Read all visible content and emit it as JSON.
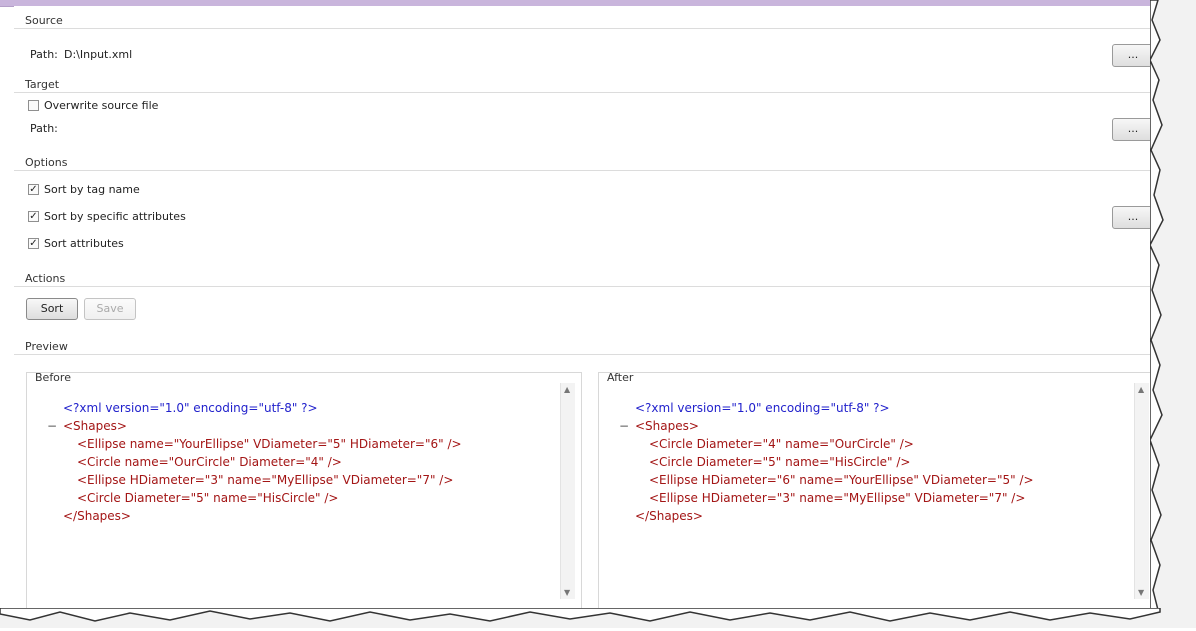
{
  "source": {
    "group_label": "Source",
    "path_label": "Path:",
    "path_value": "D:\\Input.xml",
    "browse_label": "..."
  },
  "target": {
    "group_label": "Target",
    "overwrite_label": "Overwrite source file",
    "overwrite_checked": false,
    "path_label": "Path:",
    "browse_label": "..."
  },
  "options": {
    "group_label": "Options",
    "items": [
      {
        "label": "Sort by tag name",
        "checked": true
      },
      {
        "label": "Sort by specific attributes",
        "checked": true
      },
      {
        "label": "Sort attributes",
        "checked": true
      }
    ],
    "browse_label": "..."
  },
  "actions": {
    "group_label": "Actions",
    "sort_label": "Sort",
    "save_label": "Save"
  },
  "preview": {
    "group_label": "Preview",
    "before_label": "Before",
    "after_label": "After",
    "before_lines": [
      "<?xml version=\"1.0\" encoding=\"utf-8\" ?>",
      "<Shapes>",
      "<Ellipse name=\"YourEllipse\" VDiameter=\"5\" HDiameter=\"6\" />",
      "<Circle name=\"OurCircle\" Diameter=\"4\" />",
      "<Ellipse HDiameter=\"3\" name=\"MyEllipse\" VDiameter=\"7\" />",
      "<Circle Diameter=\"5\" name=\"HisCircle\" />",
      "</Shapes>"
    ],
    "after_lines": [
      "<?xml version=\"1.0\" encoding=\"utf-8\" ?>",
      "<Shapes>",
      "<Circle Diameter=\"4\" name=\"OurCircle\" />",
      "<Circle Diameter=\"5\" name=\"HisCircle\" />",
      "<Ellipse HDiameter=\"6\" name=\"YourEllipse\" VDiameter=\"5\" />",
      "<Ellipse HDiameter=\"3\" name=\"MyEllipse\" VDiameter=\"7\" />",
      "</Shapes>"
    ]
  },
  "icons": {
    "checkbox_checked": "check-mark",
    "collapse": "minus-sign",
    "scroll_up": "up-arrow",
    "scroll_down": "down-arrow"
  }
}
